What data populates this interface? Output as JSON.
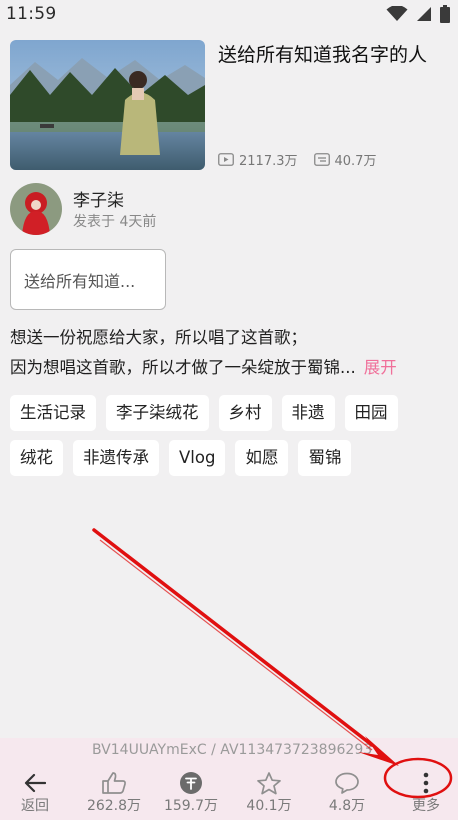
{
  "status": {
    "time": "11:59"
  },
  "video": {
    "title": "送给所有知道我名字的人",
    "views": "2117.3万",
    "danmaku": "40.7万"
  },
  "author": {
    "name": "李子柒",
    "posted": "发表于 4天前"
  },
  "collection": {
    "label": "送给所有知道..."
  },
  "description": {
    "line1": "想送一份祝愿给大家，所以唱了这首歌；",
    "line2": "因为想唱这首歌，所以才做了一朵绽放于蜀锦...",
    "expand": "展开"
  },
  "tags": [
    "生活记录",
    "李子柒绒花",
    "乡村",
    "非遗",
    "田园",
    "绒花",
    "非遗传承",
    "Vlog",
    "如愿",
    "蜀锦"
  ],
  "bottom": {
    "ids": "BV14UUAYmExC / AV113473723896293",
    "back": "返回",
    "likes": "262.8万",
    "coins": "159.7万",
    "favorites": "40.1万",
    "comments": "4.8万",
    "more": "更多"
  },
  "colors": {
    "accent": "#f0709a",
    "annotation": "#e01010"
  }
}
